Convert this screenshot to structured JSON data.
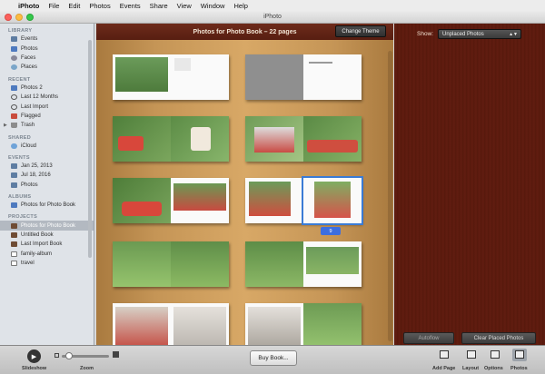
{
  "menubar": {
    "app": "iPhoto",
    "items": [
      "File",
      "Edit",
      "Photos",
      "Events",
      "Share",
      "View",
      "Window",
      "Help"
    ]
  },
  "window": {
    "title": "iPhoto"
  },
  "sidebar": {
    "library": {
      "heading": "LIBRARY",
      "items": [
        "Events",
        "Photos",
        "Faces",
        "Places"
      ]
    },
    "recent": {
      "heading": "RECENT",
      "items": [
        "Photos 2",
        "Last 12 Months",
        "Last Import",
        "Flagged",
        "Trash"
      ]
    },
    "shared": {
      "heading": "SHARED",
      "items": [
        "iCloud"
      ]
    },
    "events": {
      "heading": "EVENTS",
      "items": [
        "Jan 25, 2013",
        "Jul 18, 2016",
        "Photos"
      ]
    },
    "albums": {
      "heading": "ALBUMS",
      "items": [
        "Photos for Photo Book"
      ]
    },
    "projects": {
      "heading": "PROJECTS",
      "items": [
        "Photos for Photo Book",
        "Untitled Book",
        "Last Import Book",
        "family-album",
        "travel"
      ]
    }
  },
  "book": {
    "title": "Photos for Photo Book – 22 pages",
    "change_theme": "Change Theme",
    "selected_page": "9"
  },
  "right_panel": {
    "show_label": "Show:",
    "show_value": "Unplaced Photos",
    "autoflow": "Autoflow",
    "clear_placed": "Clear Placed Photos"
  },
  "toolbar": {
    "slideshow": "Slideshow",
    "zoom": "Zoom",
    "buy_book": "Buy Book...",
    "add_page": "Add Page",
    "layout": "Layout",
    "options": "Options",
    "photos": "Photos"
  },
  "colors": {
    "header_bar": "#6e2b1b",
    "wood": "#d8a866",
    "selection": "#3a7bd5",
    "right_panel": "#5a1a0e"
  }
}
